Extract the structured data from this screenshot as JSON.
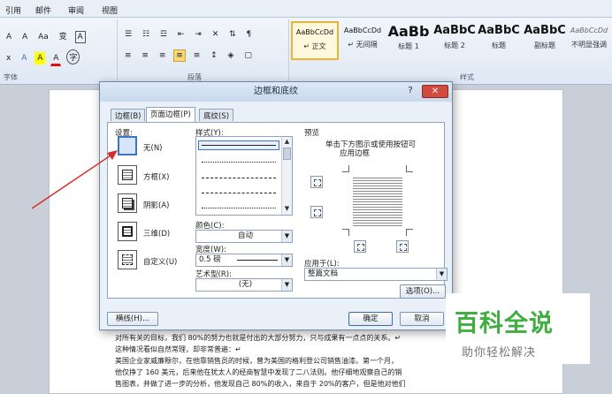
{
  "ribbon": {
    "menu_tabs": [
      "引用",
      "邮件",
      "审阅",
      "视图"
    ],
    "font_row1": [
      "A",
      "A",
      "Aa",
      "变",
      "A"
    ],
    "font_row2": [
      "x",
      "A",
      "A",
      "A",
      "字"
    ],
    "paragraph_row2": [
      "≡",
      "≡",
      "≡",
      "≡",
      "≡"
    ],
    "group_font": "字体",
    "group_paragraph": "段落",
    "group_styles": "样式",
    "styles": [
      {
        "sample": "AaBbCcDd",
        "name": "↵ 正文"
      },
      {
        "sample": "AaBbCcDd",
        "name": "↵ 无间隔"
      },
      {
        "sample": "AaBb",
        "name": "标题 1"
      },
      {
        "sample": "AaBbC",
        "name": "标题 2"
      },
      {
        "sample": "AaBbC",
        "name": "标题"
      },
      {
        "sample": "AaBbC",
        "name": "副标题"
      },
      {
        "sample": "AaBbCcDd",
        "name": "不明显强调"
      }
    ],
    "accent": "#e6b33b"
  },
  "document": {
    "lines": [
      "对所有关的目标，我们 80%的努力也就是付出的大部分努力，只与成果有一点点的关系。↵",
      "这种情况看似自然常理，却非常普遍：↵",
      "美国企业家威廉穆尔，在他靠销售员的时候，曾为美国的格利登公司销售油漆。第一个月，",
      "他仅挣了 160 美元，后来他在犹太人的经商智慧中发现了二八法则。他仔细地观察自己的销",
      "售图表，并做了进一步的分析，他发现自己 80%的收入，来自于 20%的客户，但是他对他们"
    ]
  },
  "dialog": {
    "title": "边框和底纹",
    "help": "?",
    "close": "✕",
    "tabs": [
      "边框(B)",
      "页面边框(P)",
      "底纹(S)"
    ],
    "settings_label": "设置:",
    "settings": [
      "无(N)",
      "方框(X)",
      "阴影(A)",
      "三维(D)",
      "自定义(U)"
    ],
    "style_label": "样式(Y):",
    "color_label": "颜色(C):",
    "color_value": "自动",
    "width_label": "宽度(W):",
    "width_value": "0.5 磅",
    "art_label": "艺术型(R):",
    "art_value": "(无)",
    "preview_label": "预览",
    "preview_hint_1": "单击下方图示或使用按钮可",
    "preview_hint_2": "应用边框",
    "apply_label": "应用于(L):",
    "apply_value": "整篇文档",
    "options_button": "选项(O)...",
    "hline_button": "横线(H)...",
    "ok_button": "确定",
    "cancel_button": "取消"
  },
  "watermark": {
    "title": "百科全说",
    "subtitle": "助你轻松解决"
  }
}
